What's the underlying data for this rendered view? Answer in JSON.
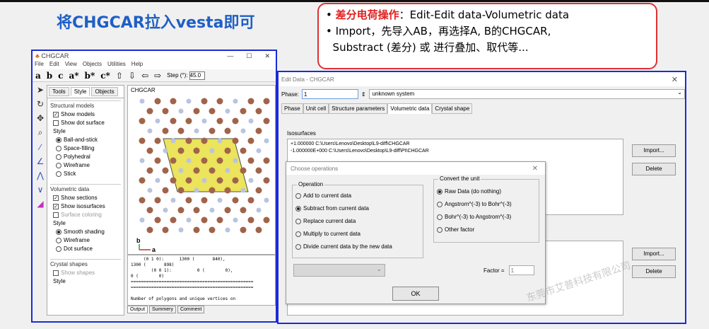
{
  "slide": {
    "title": "将CHGCAR拉入vesta即可",
    "callout_line1_red": "差分电荷操作",
    "callout_line1_rest": "：Edit-Edit data-Volumetric data",
    "callout_line2": "Import，先导入AB，再选择A, B的CHGCAR,",
    "callout_line3": "Substract (差分) 或 进行叠加、取代等..."
  },
  "vesta": {
    "title": "CHGCAR",
    "menu": [
      "File",
      "Edit",
      "View",
      "Objects",
      "Utilities",
      "Help"
    ],
    "toolbar_axes": [
      "a",
      "b",
      "c",
      "a*",
      "b*",
      "c*"
    ],
    "step_label": "Step (°):",
    "step_value": "45.0",
    "tabs": [
      "Tools",
      "Style",
      "Objects"
    ],
    "structural_models": {
      "title": "Structural models",
      "show_models": "Show models",
      "show_dot_surface": "Show dot surface",
      "style_label": "Style",
      "styles": [
        "Ball-and-stick",
        "Space-filling",
        "Polyhedral",
        "Wireframe",
        "Stick"
      ]
    },
    "volumetric_data": {
      "title": "Volumetric data",
      "show_sections": "Show sections",
      "show_isosurfaces": "Show isosurfaces",
      "surface_coloring": "Surface coloring",
      "style_label": "Style",
      "styles": [
        "Smooth shading",
        "Wireframe",
        "Dot surface"
      ]
    },
    "crystal_shapes": {
      "title": "Crystal shapes",
      "show_shapes": "Show shapes",
      "style_label": "Style"
    },
    "viewer_title": "CHGCAR",
    "axis_b": "b",
    "axis_a": "a",
    "output_lines": "     (0 1 0):      1300 (       840),\n1300 (       898)\n        (0 0 1):          0 (        0),\n0 (        0)\n================================================\n================================================\n\nNumber of polygons and unique vertices on",
    "output_tabs": [
      "Output",
      "Summery",
      "Comment"
    ]
  },
  "edit_data": {
    "title": "Edit Data - CHGCAR",
    "phase_label": "Phase:",
    "phase_value": "1",
    "system": "unknown system",
    "tabs": [
      "Phase",
      "Unit cell",
      "Structure parameters",
      "Volumetric data",
      "Crystal shape"
    ],
    "isosurfaces_label": "Isosurfaces",
    "iso_line1": "+1.000000 C:\\Users\\Lenovo\\Desktop\\L9-diff\\CHGCAR",
    "iso_line2": "-1.000000E+000 C:\\Users\\Lenovo\\Desktop\\L9-diff\\Pt\\CHGCAR",
    "import_label": "Import...",
    "delete_label": "Delete",
    "import2_label": "Import...",
    "delete2_label": "Delete"
  },
  "choose_ops": {
    "title": "Choose operations",
    "operation_label": "Operation",
    "operations": [
      "Add to current data",
      "Subtract from current data",
      "Replace current data",
      "Multiply to current data",
      "Divide current data by the new data"
    ],
    "selected_operation": "Subtract from current data",
    "convert_label": "Convert the unit",
    "units": [
      "Raw Data (do nothing)",
      "Angstrom^(-3) to Bohr^(-3)",
      "Bohr^(-3) to Angstrom^(-3)",
      "Other factor"
    ],
    "factor_label": "Factor =",
    "factor_value": "1",
    "ok_label": "OK"
  },
  "watermark": "东莞市艾普科技有限公司",
  "colors": {
    "title_blue": "#1f5fc6",
    "callout_red": "#e02020",
    "frame_blue": "#1b2bd6",
    "isosurface_yellow": "#e8e040",
    "atom_brown": "#a0644a",
    "atom_blue": "#b8c4e0"
  }
}
